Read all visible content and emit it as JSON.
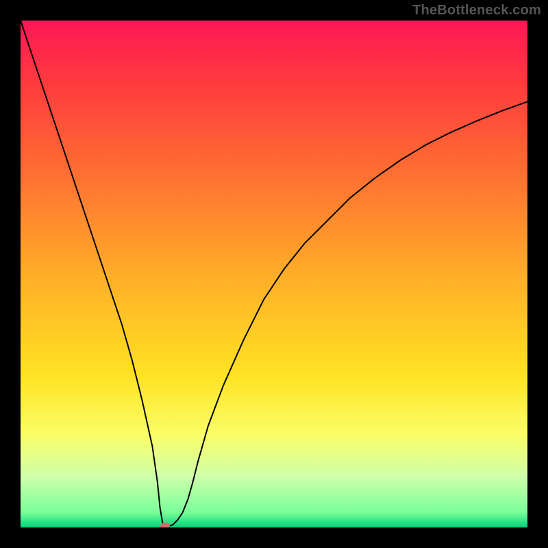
{
  "watermark": "TheBottleneck.com",
  "chart_data": {
    "type": "line",
    "title": "",
    "xlabel": "",
    "ylabel": "",
    "xlim": [
      0,
      100
    ],
    "ylim": [
      0,
      100
    ],
    "grid": false,
    "legend": false,
    "background_gradient": {
      "stops": [
        {
          "offset": 0.0,
          "color": "#ff1756"
        },
        {
          "offset": 0.12,
          "color": "#ff3a3f"
        },
        {
          "offset": 0.3,
          "color": "#ff6e32"
        },
        {
          "offset": 0.5,
          "color": "#ffad27"
        },
        {
          "offset": 0.7,
          "color": "#ffe223"
        },
        {
          "offset": 0.82,
          "color": "#f9ff68"
        },
        {
          "offset": 0.9,
          "color": "#ceffaa"
        },
        {
          "offset": 0.97,
          "color": "#7aff9a"
        },
        {
          "offset": 1.0,
          "color": "#00d37a"
        }
      ]
    },
    "series": [
      {
        "name": "curve",
        "x": [
          0,
          2,
          5,
          8,
          11,
          14,
          17,
          20,
          22,
          24,
          26,
          27,
          27.5,
          28,
          28.5,
          29,
          30,
          31,
          32,
          33,
          34,
          35,
          37,
          40,
          44,
          48,
          52,
          56,
          60,
          65,
          70,
          75,
          80,
          85,
          90,
          95,
          100
        ],
        "values": [
          100,
          94,
          85,
          76,
          67,
          58,
          49,
          40,
          33,
          25,
          16,
          9,
          4,
          1,
          0.3,
          0.2,
          0.5,
          1.5,
          3,
          5.5,
          9,
          13,
          20,
          28,
          37,
          45,
          51,
          56,
          60,
          65,
          69,
          72.5,
          75.5,
          78,
          80.2,
          82.2,
          84
        ]
      }
    ],
    "marker": {
      "x": 28.5,
      "y": 0.3,
      "color": "#cc6f6d"
    }
  }
}
